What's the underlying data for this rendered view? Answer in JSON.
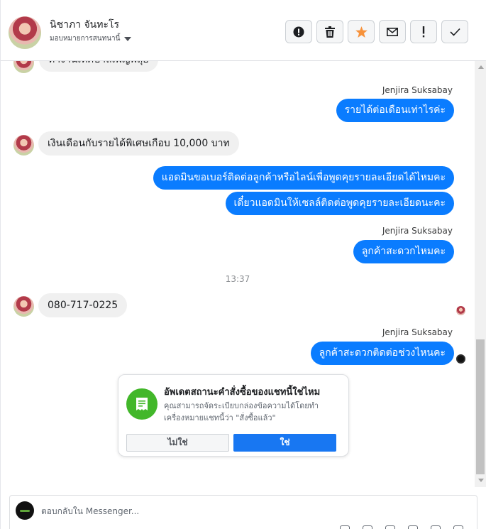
{
  "header": {
    "contact_name": "นิชาภา จันทะโร",
    "assign_label": "มอบหมายการสนทนานี้",
    "actions": [
      {
        "icon": "spam-icon",
        "color": "#1c1e21"
      },
      {
        "icon": "trash-icon",
        "color": "#1c1e21"
      },
      {
        "icon": "star-icon",
        "color": "#f7923b"
      },
      {
        "icon": "mail-icon",
        "color": "#1c1e21"
      },
      {
        "icon": "follow-up-icon",
        "color": "#1c1e21"
      },
      {
        "icon": "check-icon",
        "color": "#1c1e21"
      }
    ]
  },
  "thread": {
    "partial_top_message": "ทำงานเทศบาลเพ็ญพลุ่ย",
    "sender_1": "Jenjira Suksabay",
    "out_1": "รายได้ต่อเดือนเท่าไรค่ะ",
    "in_1": "เงินเดือนกับรายได้พิเศษเกือบ 10,000 บาท",
    "out_2": "แอดมินขอเบอร์ติดต่อลูกค้าหรือไลน์เพื่อพูดคุยรายละเอียดได้ไหมคะ",
    "out_3": "เดี๋ยวแอดมินให้เซลล์ติดต่อพูดคุยรายละเอียดนะคะ",
    "sender_2": "Jenjira Suksabay",
    "out_4": "ลูกค้าสะดวกไหมคะ",
    "timestamp": "13:37",
    "in_2": "080-717-0225",
    "sender_3": "Jenjira Suksabay",
    "out_5": "ลูกค้าสะดวกติดต่อช่วงไหนคะ"
  },
  "order_prompt": {
    "title": "อัพเดตสถานะคำสั่งซื้อของแชทนี้ใช่ไหม",
    "body": "คุณสามารถจัดระเบียบกล่องข้อความได้โดยทำเครื่องหมายแชทนี้ว่า \"สั่งซื้อแล้ว\"",
    "no_label": "ไม่ใช่",
    "yes_label": "ใช่",
    "accent": "#1877f2",
    "icon_color": "#42b72a"
  },
  "composer": {
    "placeholder": "ตอบกลับใน Messenger..."
  },
  "colors": {
    "outgoing_bubble": "#0a7cff",
    "incoming_bubble": "#f0f0f0"
  }
}
